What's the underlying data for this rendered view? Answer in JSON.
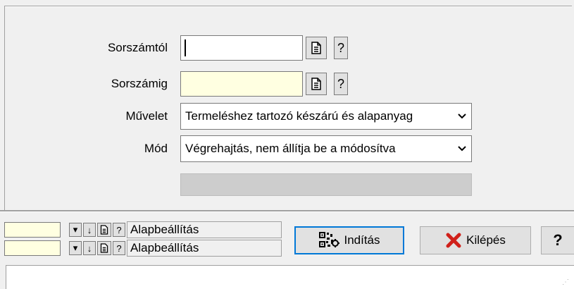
{
  "form": {
    "from_label": "Sorszámtól",
    "to_label": "Sorszámig",
    "operation_label": "Művelet",
    "mode_label": "Mód",
    "from_value": "",
    "to_value": "",
    "operation_value": "Termeléshez tartozó készárú és alapanyag",
    "mode_value": "Végrehajtás, nem állítja be a módosítva"
  },
  "small_buttons": {
    "question": "?",
    "down_arrow": "↓",
    "dropdown": "▾"
  },
  "settings_rows": [
    {
      "label": "Alapbeállítás",
      "value": ""
    },
    {
      "label": "Alapbeállítás",
      "value": ""
    }
  ],
  "actions": {
    "start_label": "Indítás",
    "exit_label": "Kilépés",
    "help_label": "?"
  },
  "colors": {
    "required_field_bg": "#ffffe1",
    "exit_icon": "#d0201a",
    "focus_border": "#0078d7"
  },
  "icons": {
    "list_icon": "document-list-icon",
    "start_icon": "qr-run-icon",
    "exit_icon": "red-x-icon",
    "dropdown_icon": "chevron-down-icon"
  }
}
